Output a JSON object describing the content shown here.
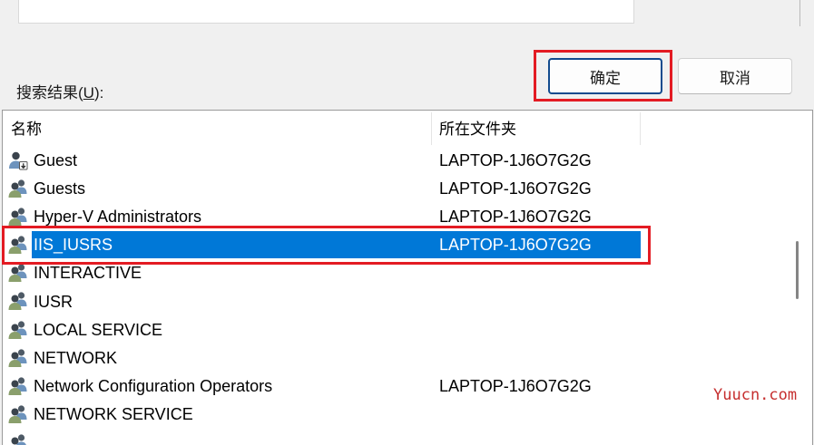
{
  "dialog": {
    "ok_label": "确定",
    "cancel_label": "取消",
    "results_label_prefix": "搜索结果(",
    "results_label_accel": "U",
    "results_label_suffix": "):"
  },
  "results": {
    "columns": {
      "name": "名称",
      "folder": "所在文件夹"
    },
    "selected_index": 3,
    "rows": [
      {
        "name": "Guest",
        "folder": "LAPTOP-1J6O7G2G",
        "icon": "guest-user-icon"
      },
      {
        "name": "Guests",
        "folder": "LAPTOP-1J6O7G2G",
        "icon": "group-icon"
      },
      {
        "name": "Hyper-V Administrators",
        "folder": "LAPTOP-1J6O7G2G",
        "icon": "group-icon"
      },
      {
        "name": "IIS_IUSRS",
        "folder": "LAPTOP-1J6O7G2G",
        "icon": "group-icon"
      },
      {
        "name": "INTERACTIVE",
        "folder": "",
        "icon": "group-icon"
      },
      {
        "name": "IUSR",
        "folder": "",
        "icon": "group-icon"
      },
      {
        "name": "LOCAL SERVICE",
        "folder": "",
        "icon": "group-icon"
      },
      {
        "name": "NETWORK",
        "folder": "",
        "icon": "group-icon"
      },
      {
        "name": "Network Configuration Operators",
        "folder": "LAPTOP-1J6O7G2G",
        "icon": "group-icon"
      },
      {
        "name": "NETWORK SERVICE",
        "folder": "",
        "icon": "group-icon"
      }
    ]
  },
  "watermark": "Yuucn.com",
  "colors": {
    "selection": "#0078d7",
    "annotation": "#e31b23",
    "watermark": "#c62f2f"
  }
}
